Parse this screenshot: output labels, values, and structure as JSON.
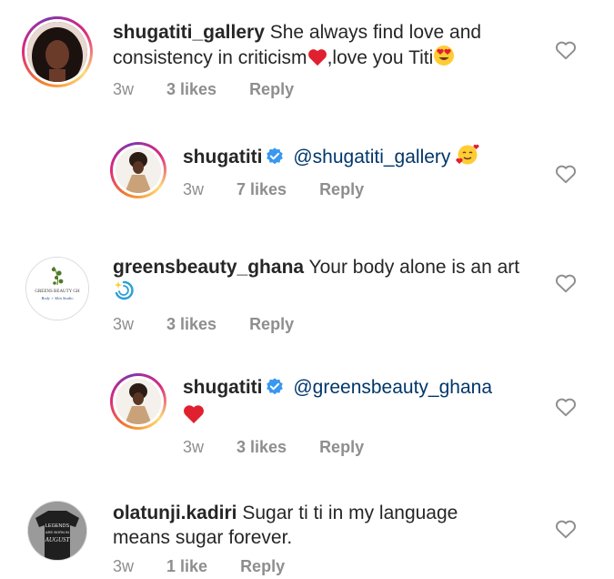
{
  "comments": [
    {
      "username": "shugatiti_gallery",
      "text": "She always find love and consistency in criticism",
      "text_after": ",love you Titi",
      "time": "3w",
      "likes": "3 likes",
      "reply": "Reply"
    },
    {
      "username": "shugatiti",
      "mention": "@shugatiti_gallery",
      "time": "3w",
      "likes": "7 likes",
      "reply": "Reply"
    },
    {
      "username": "greensbeauty_ghana",
      "text": "Your body alone is an art",
      "time": "3w",
      "likes": "3 likes",
      "reply": "Reply",
      "avatar_line1": "GREENS BEAUTY GH",
      "avatar_line2": "Body + Skin Studio"
    },
    {
      "username": "shugatiti",
      "mention": "@greensbeauty_ghana",
      "time": "3w",
      "likes": "3 likes",
      "reply": "Reply"
    },
    {
      "username": "olatunji.kadiri",
      "text": "Sugar ti ti in my language means sugar forever.",
      "time": "3w",
      "likes": "1 like",
      "reply": "Reply",
      "avatar_line1": "LEGENDS",
      "avatar_line2": "ARE BORN IN",
      "avatar_line3": "AUGUST"
    }
  ],
  "colors": {
    "mention": "#00376b",
    "meta": "#8e8e8e",
    "verified": "#3897f0",
    "heart_red": "#ed1c24"
  },
  "icons": [
    "heart-outline-icon",
    "verified-badge-icon",
    "red-heart-emoji",
    "heart-eyes-emoji",
    "smiling-face-with-hearts-emoji",
    "dizzy-emoji"
  ]
}
